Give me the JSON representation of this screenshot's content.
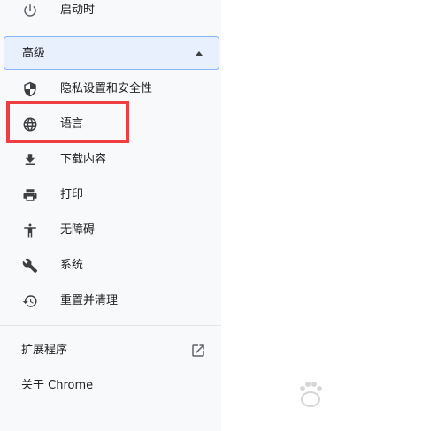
{
  "sidebar": {
    "startup": {
      "label": "启动时",
      "icon": "power-icon"
    },
    "advanced": {
      "label": "高级",
      "icon": "arrow-up-icon"
    },
    "items": [
      {
        "label": "隐私设置和安全性",
        "icon": "shield-icon"
      },
      {
        "label": "语言",
        "icon": "globe-icon"
      },
      {
        "label": "下载内容",
        "icon": "download-icon"
      },
      {
        "label": "打印",
        "icon": "printer-icon"
      },
      {
        "label": "无障碍",
        "icon": "accessibility-icon"
      },
      {
        "label": "系统",
        "icon": "wrench-icon"
      },
      {
        "label": "重置并清理",
        "icon": "restore-icon"
      }
    ],
    "extensions": {
      "label": "扩展程序",
      "icon": "open-in-new-icon"
    },
    "about": {
      "label": "关于 Chrome"
    }
  },
  "colors": {
    "highlight": "#ef3e42",
    "advanced_bg": "#e8f0fe",
    "sidebar_bg": "#f8f9fa"
  }
}
